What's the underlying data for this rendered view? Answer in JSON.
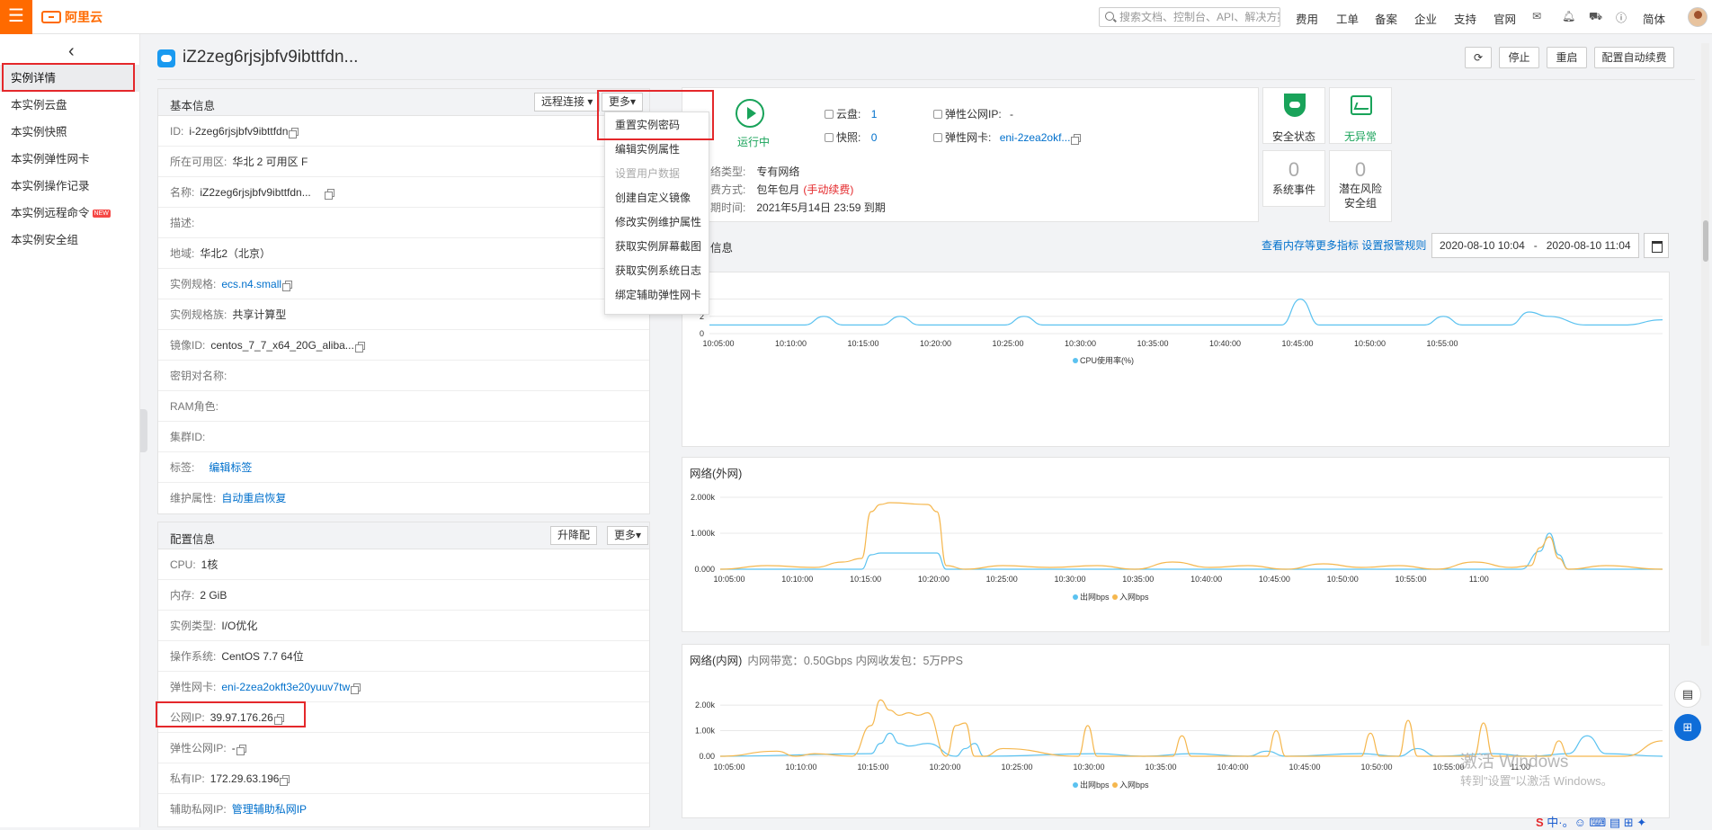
{
  "topbar": {
    "logo": "阿里云",
    "search_placeholder": "搜索文档、控制台、API、解决方案和资源",
    "nav": [
      "费用",
      "工单",
      "备案",
      "企业",
      "支持",
      "官网"
    ],
    "lang": "简体"
  },
  "sidebar": {
    "items": [
      {
        "label": "实例详情"
      },
      {
        "label": "本实例云盘"
      },
      {
        "label": "本实例快照"
      },
      {
        "label": "本实例弹性网卡"
      },
      {
        "label": "本实例操作记录"
      },
      {
        "label": "本实例远程命令",
        "badge": "NEW"
      },
      {
        "label": "本实例安全组"
      }
    ]
  },
  "header": {
    "title": "iZ2zeg6rjsjbfv9ibttfdn...",
    "buttons": {
      "stop": "停止",
      "restart": "重启",
      "renew": "配置自动续费"
    }
  },
  "basic": {
    "title": "基本信息",
    "remote": "远程连接",
    "more": "更多",
    "rows": [
      {
        "label": "ID:",
        "value": "i-2zeg6rjsjbfv9ibttfdn"
      },
      {
        "label": "所在可用区:",
        "value": "华北 2 可用区 F"
      },
      {
        "label": "名称:",
        "value": "iZ2zeg6rjsjbfv9ibttfdn..."
      },
      {
        "label": "描述:",
        "value": ""
      },
      {
        "label": "地域:",
        "value": "华北2（北京）"
      },
      {
        "label": "实例规格:",
        "value": "ecs.n4.small"
      },
      {
        "label": "实例规格族:",
        "value": "共享计算型"
      },
      {
        "label": "镜像ID:",
        "value": "centos_7_7_x64_20G_aliba..."
      },
      {
        "label": "密钥对名称:",
        "value": ""
      },
      {
        "label": "RAM角色:",
        "value": ""
      },
      {
        "label": "集群ID:",
        "value": ""
      },
      {
        "label": "标签:",
        "value": "编辑标签"
      },
      {
        "label": "维护属性:",
        "value": "自动重启恢复"
      }
    ]
  },
  "config": {
    "title": "配置信息",
    "upgrade": "升降配",
    "more": "更多",
    "rows": [
      {
        "label": "CPU:",
        "value": "1核"
      },
      {
        "label": "内存:",
        "value": "2 GiB"
      },
      {
        "label": "实例类型:",
        "value": "I/O优化"
      },
      {
        "label": "操作系统:",
        "value": "CentOS 7.7 64位"
      },
      {
        "label": "弹性网卡:",
        "value": "eni-2zea2okft3e20yuuv7tw"
      },
      {
        "label": "公网IP:",
        "value": "39.97.176.26"
      },
      {
        "label": "弹性公网IP:",
        "value": "-"
      },
      {
        "label": "私有IP:",
        "value": "172.29.63.196"
      },
      {
        "label": "辅助私网IP:",
        "value": "管理辅助私网IP"
      }
    ]
  },
  "dropdown": {
    "items": [
      "重置实例密码",
      "编辑实例属性",
      "设置用户数据",
      "创建自定义镜像",
      "修改实例维护属性",
      "获取实例屏幕截图",
      "获取实例系统日志",
      "绑定辅助弹性网卡"
    ]
  },
  "status": {
    "state": "运行中",
    "disk_label": "云盘:",
    "disk_value": "1",
    "snap_label": "快照:",
    "snap_value": "0",
    "eip_label": "弹性公网IP:",
    "eip_value": "-",
    "eni_label": "弹性网卡:",
    "eni_value": "eni-2zea2okf...",
    "net_label": "络类型:",
    "net_value": "专有网络",
    "pay_label": "费方式:",
    "pay_value": "包年包月",
    "pay_note": "(手动续费)",
    "exp_label": "期时间:",
    "exp_value": "2021年5月14日 23:59 到期"
  },
  "tiles": {
    "security": "安全状态",
    "health": "无异常",
    "events_num": "0",
    "events": "系统事件",
    "risk_num": "0",
    "risk": "潜在风险安全组"
  },
  "monitor": {
    "title": "信息",
    "link1": "查看内存等更多指标",
    "link2": "设置报警规则",
    "start": "2020-08-10 10:04",
    "sep": "-",
    "end": "2020-08-10 11:04"
  },
  "charts": {
    "cpu": {
      "type": "line",
      "legend": "CPU使用率(%)",
      "ylim": [
        0,
        5
      ],
      "yticks": [
        "0",
        "2",
        "4"
      ],
      "xticks": [
        "10:05:00",
        "10:10:00",
        "10:15:00",
        "10:20:00",
        "10:25:00",
        "10:30:00",
        "10:35:00",
        "10:40:00",
        "10:45:00",
        "10:50:00",
        "10:55:00"
      ],
      "series": [
        {
          "name": "CPU使用率(%)",
          "color": "#5bc2f0",
          "x": [
            0,
            8,
            10,
            12,
            14,
            18,
            20,
            22,
            24,
            28,
            31,
            33,
            35,
            40,
            60,
            62,
            64,
            70,
            75,
            77,
            79,
            81,
            84,
            86,
            88,
            92,
            96,
            100
          ],
          "y": [
            1,
            1,
            1,
            2,
            1,
            1,
            2,
            1,
            1,
            1,
            1,
            2,
            1,
            1,
            1,
            4,
            1,
            1,
            1,
            2,
            1,
            1,
            1,
            2.5,
            2,
            1,
            1,
            1.6
          ]
        }
      ]
    },
    "net_ext": {
      "title": "网络(外网)",
      "type": "line",
      "ylim": [
        0,
        2400
      ],
      "yticks": [
        "0.000",
        "1.000k",
        "2.000k"
      ],
      "xticks": [
        "10:05:00",
        "10:10:00",
        "10:15:00",
        "10:20:00",
        "10:25:00",
        "10:30:00",
        "10:35:00",
        "10:40:00",
        "10:45:00",
        "10:50:00",
        "10:55:00",
        "11:00"
      ],
      "legend": [
        "出网bps",
        "入网bps"
      ],
      "series": [
        {
          "name": "出网bps",
          "color": "#5bc2f0",
          "x": [
            0,
            15,
            16,
            17,
            23,
            24,
            25,
            30,
            40,
            60,
            70,
            85,
            87,
            88,
            89,
            90,
            100
          ],
          "y": [
            0,
            0,
            400,
            450,
            450,
            0,
            0,
            0,
            0,
            0,
            0,
            0,
            500,
            1000,
            400,
            0,
            0
          ]
        },
        {
          "name": "入网bps",
          "color": "#f5b74e",
          "x": [
            0,
            5,
            10,
            13,
            15,
            16,
            17,
            18,
            22,
            23,
            24,
            26,
            30,
            35,
            40,
            44,
            48,
            52,
            56,
            60,
            64,
            68,
            72,
            76,
            80,
            84,
            86,
            87,
            88,
            89,
            90,
            94,
            100
          ],
          "y": [
            0,
            100,
            50,
            200,
            300,
            1600,
            1800,
            1850,
            1800,
            1600,
            100,
            0,
            100,
            50,
            100,
            0,
            200,
            50,
            100,
            0,
            150,
            50,
            100,
            0,
            200,
            50,
            100,
            600,
            900,
            300,
            0,
            100,
            0
          ]
        }
      ]
    },
    "net_int": {
      "title": "网络(内网)",
      "subtitle": "内网带宽：0.50Gbps 内网收发包：5万PPS",
      "type": "line",
      "ylim": [
        0,
        2600
      ],
      "yticks": [
        "0.00",
        "1.00k",
        "2.00k"
      ],
      "xticks": [
        "10:05:00",
        "10:10:00",
        "10:15:00",
        "10:20:00",
        "10:25:00",
        "10:30:00",
        "10:35:00",
        "10:40:00",
        "10:45:00",
        "10:50:00",
        "10:55:00",
        "11:00"
      ],
      "legend": [
        "出网bps",
        "入网bps"
      ],
      "series": [
        {
          "name": "出网bps",
          "color": "#5bc2f0",
          "x": [
            0,
            16,
            17,
            18,
            19,
            20,
            22,
            25,
            26,
            27,
            28,
            40,
            45,
            50,
            56,
            58,
            60,
            68,
            72,
            74,
            76,
            82,
            86,
            90,
            92,
            94,
            100
          ],
          "y": [
            0,
            100,
            500,
            900,
            500,
            400,
            500,
            0,
            300,
            500,
            0,
            100,
            0,
            100,
            0,
            200,
            0,
            100,
            0,
            300,
            0,
            100,
            0,
            100,
            800,
            100,
            0
          ]
        },
        {
          "name": "入网bps",
          "color": "#f5b74e",
          "x": [
            0,
            6,
            8,
            10,
            14,
            16,
            17,
            18,
            19,
            20,
            21,
            22,
            24,
            25,
            26,
            27,
            28,
            30,
            38,
            39,
            40,
            48,
            49,
            50,
            58,
            59,
            60,
            68,
            69,
            70,
            72,
            73,
            74,
            80,
            81,
            82,
            88,
            89,
            90,
            96,
            100
          ],
          "y": [
            0,
            200,
            0,
            100,
            0,
            1200,
            2200,
            1800,
            1600,
            1700,
            1600,
            1700,
            0,
            1200,
            1300,
            0,
            0,
            300,
            0,
            1200,
            0,
            0,
            800,
            0,
            0,
            1000,
            0,
            0,
            900,
            0,
            0,
            1400,
            0,
            0,
            1300,
            0,
            0,
            600,
            0,
            0,
            600
          ]
        }
      ]
    }
  },
  "watermark": {
    "line1": "激活 Windows",
    "line2": "转到\"设置\"以激活 Windows。"
  },
  "ime": "中·。☺ ⌨ ▤ ⊞ ✦"
}
